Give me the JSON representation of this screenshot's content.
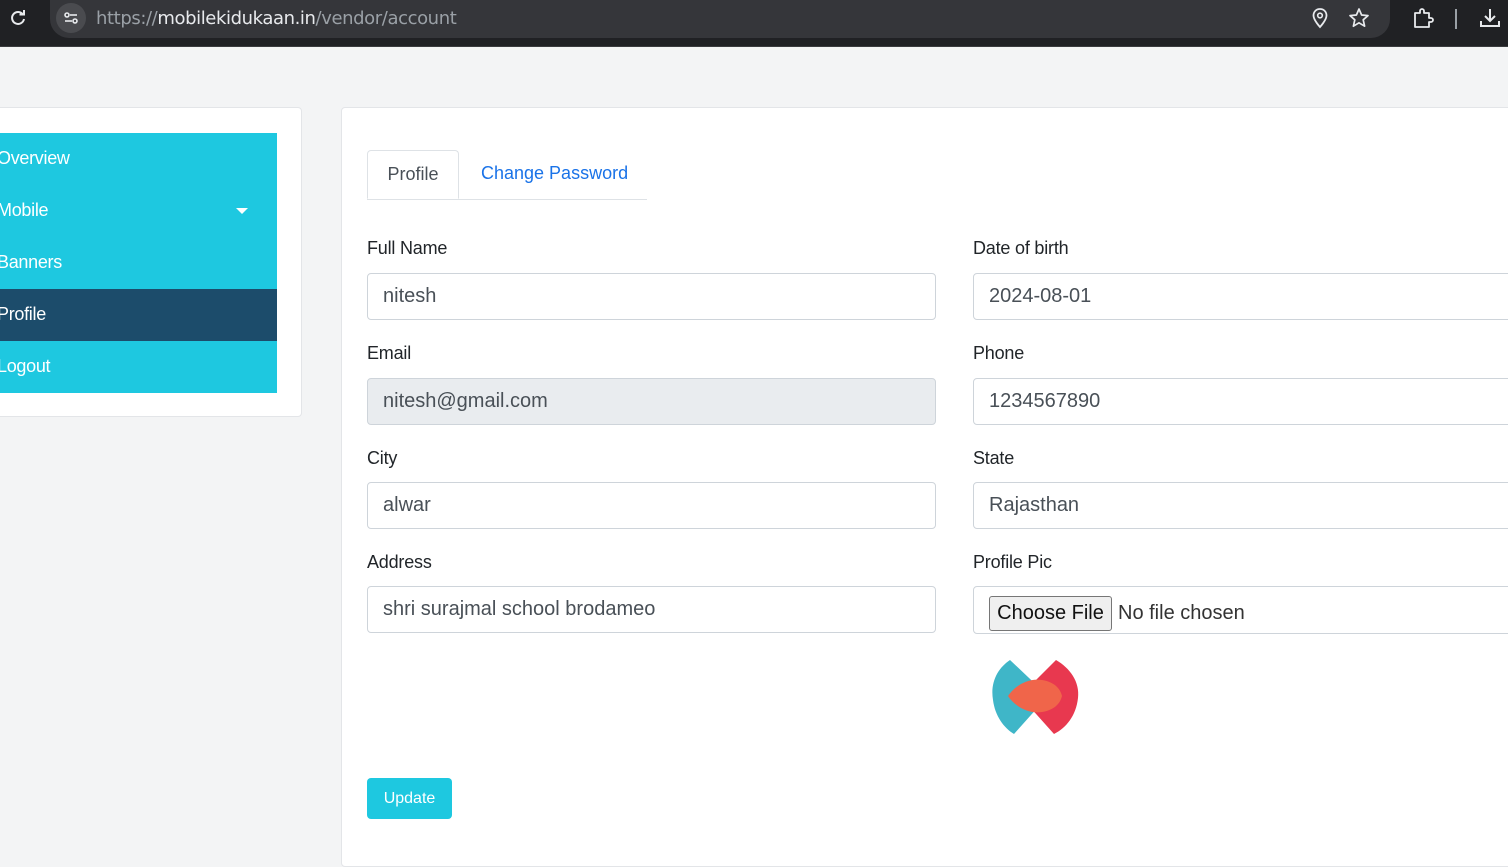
{
  "browser": {
    "url_scheme": "https://",
    "url_host": "mobilekidukaan.in",
    "url_path": "/vendor/account"
  },
  "sidebar": {
    "items": [
      {
        "label": "Overview"
      },
      {
        "label": "Mobile"
      },
      {
        "label": "Banners"
      },
      {
        "label": "Profile"
      },
      {
        "label": "Logout"
      }
    ]
  },
  "tabs": {
    "profile": "Profile",
    "change_password": "Change Password"
  },
  "form": {
    "full_name_label": "Full Name",
    "full_name_value": "nitesh",
    "dob_label": "Date of birth",
    "dob_value": "2024-08-01",
    "email_label": "Email",
    "email_value": "nitesh@gmail.com",
    "phone_label": "Phone",
    "phone_value": "1234567890",
    "city_label": "City",
    "city_value": "alwar",
    "state_label": "State",
    "state_value": "Rajasthan",
    "address_label": "Address",
    "address_value": "shri surajmal school brodameo",
    "profile_pic_label": "Profile Pic",
    "choose_file": "Choose File",
    "no_file": "No file chosen",
    "update_label": "Update"
  },
  "colors": {
    "accent": "#1ec8e0",
    "sidebar_active": "#1c4c6b",
    "link": "#1a73e8"
  }
}
